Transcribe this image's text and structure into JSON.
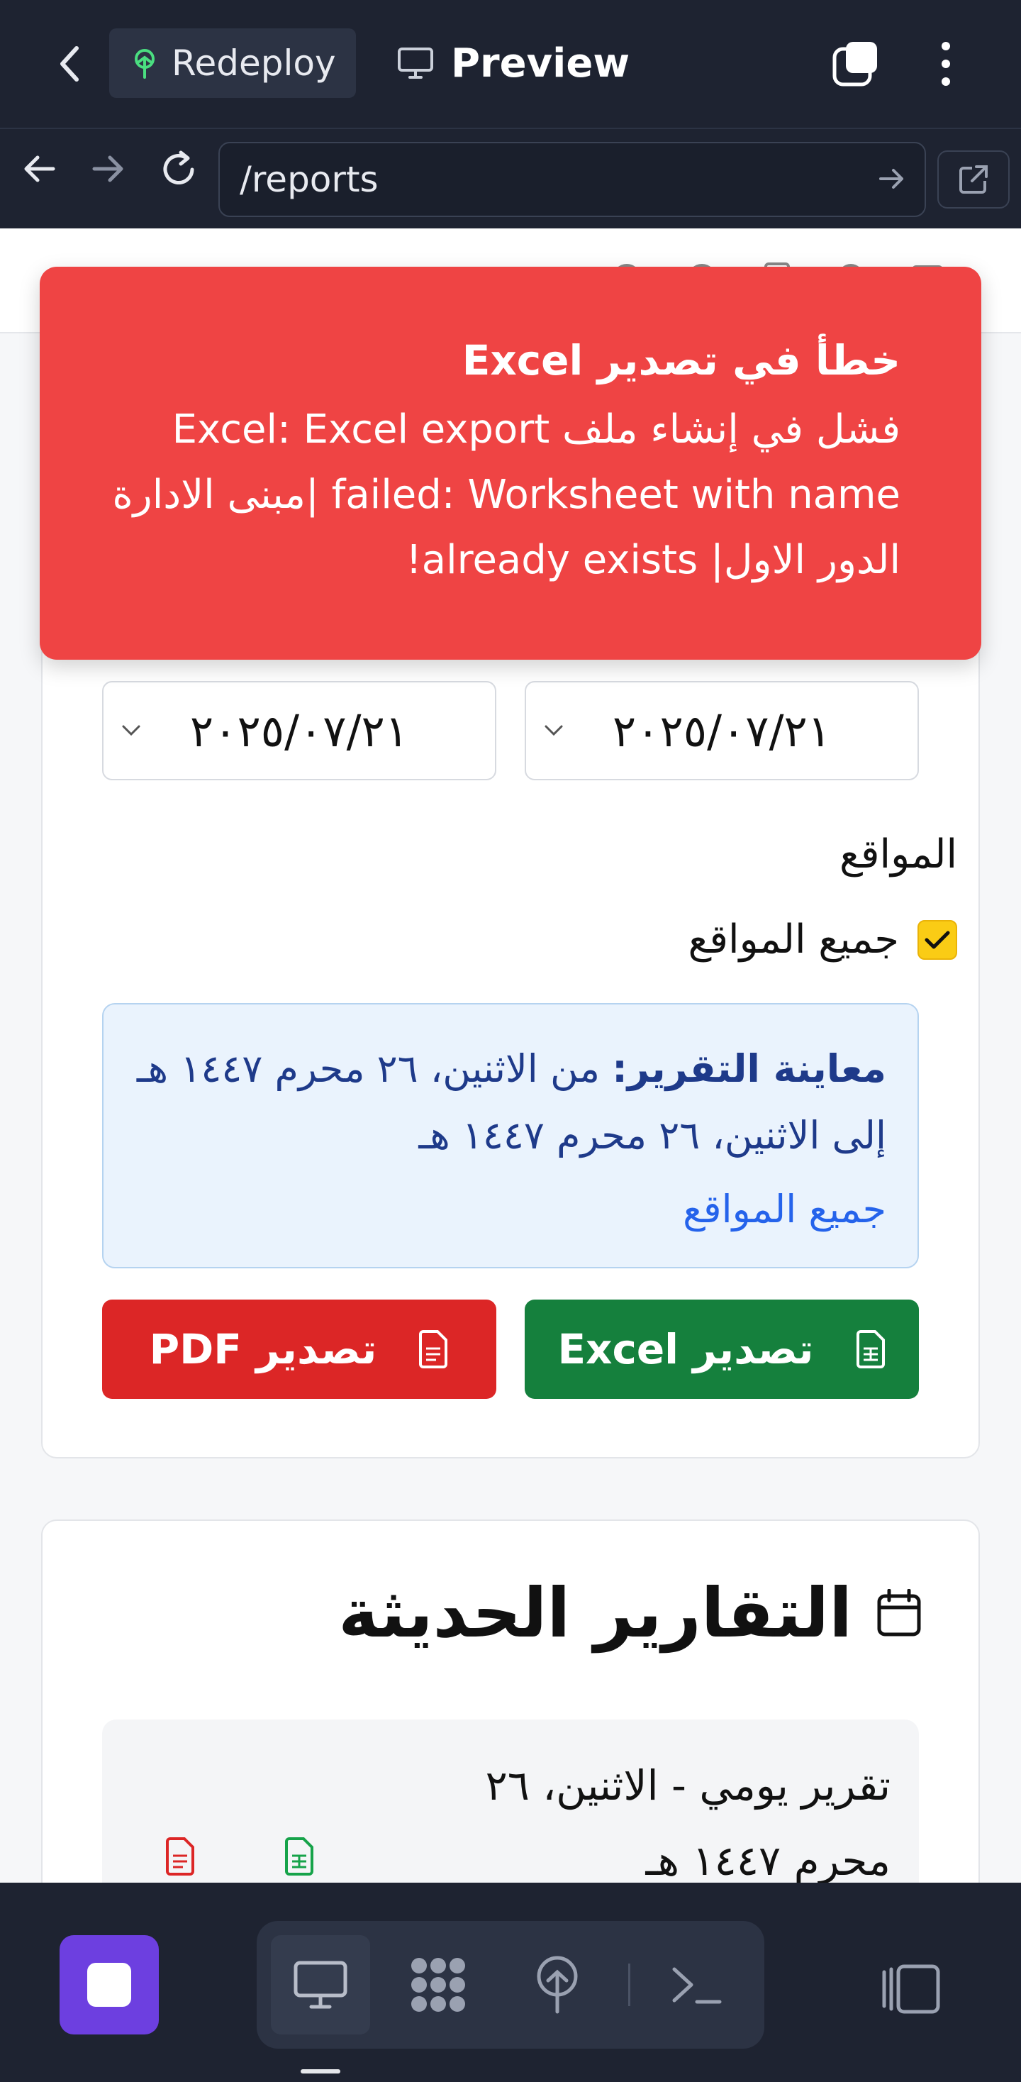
{
  "topbar": {
    "redeploy_label": "Redeploy",
    "preview_label": "Preview"
  },
  "urlbar": {
    "url": "/reports"
  },
  "toast": {
    "title": "خطأ في تصدير Excel",
    "message": "فشل في إنشاء ملف Excel: Excel export failed: Worksheet with name |مبنى الادارة الدور الاول| already exists!"
  },
  "filters": {
    "date_to": "٢٠٢٥/٠٧/٢١",
    "date_from": "٢٠٢٥/٠٧/٢١",
    "sites_label": "المواقع",
    "all_sites_label": "جميع المواقع",
    "all_sites_checked": true
  },
  "report_preview": {
    "label": "معاينة التقرير:",
    "range": "من الاثنين، ٢٦ محرم ١٤٤٧ هـ إلى الاثنين، ٢٦ محرم ١٤٤٧ هـ",
    "sites": "جميع المواقع"
  },
  "export": {
    "excel_label": "تصدير Excel",
    "pdf_label": "تصدير PDF"
  },
  "recent": {
    "title": "التقارير الحديثة",
    "items": [
      {
        "label": "تقرير يومي - الاثنين، ٢٦ محرم ١٤٤٧ هـ"
      }
    ]
  },
  "colors": {
    "toast_bg": "#ef4444",
    "excel_btn": "#15803d",
    "pdf_btn": "#dc2626",
    "checkbox": "#facc15",
    "accent_stop": "#6d3fe0"
  }
}
